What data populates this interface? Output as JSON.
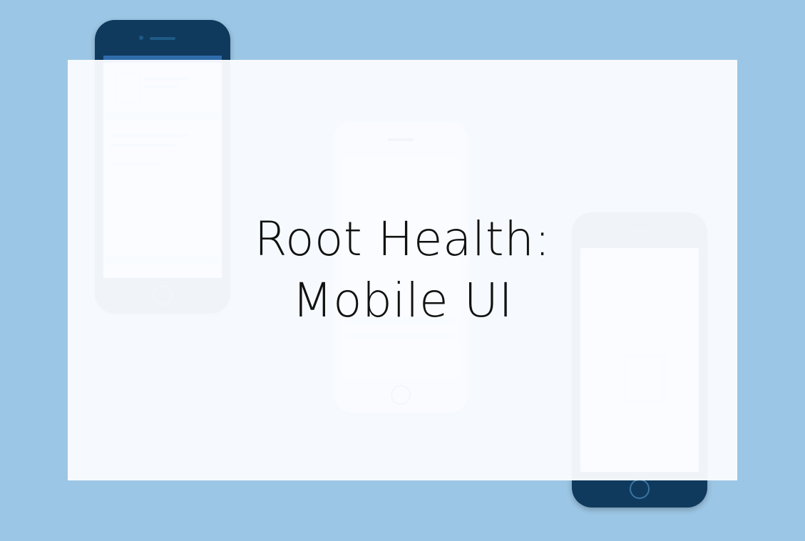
{
  "title": {
    "line1": "Root Health:",
    "line2": "Mobile UI"
  },
  "colors": {
    "background": "#9cc6e5",
    "overlay": "#fafcff",
    "phone_body": "#0f3a5e",
    "title_text": "#111111"
  }
}
